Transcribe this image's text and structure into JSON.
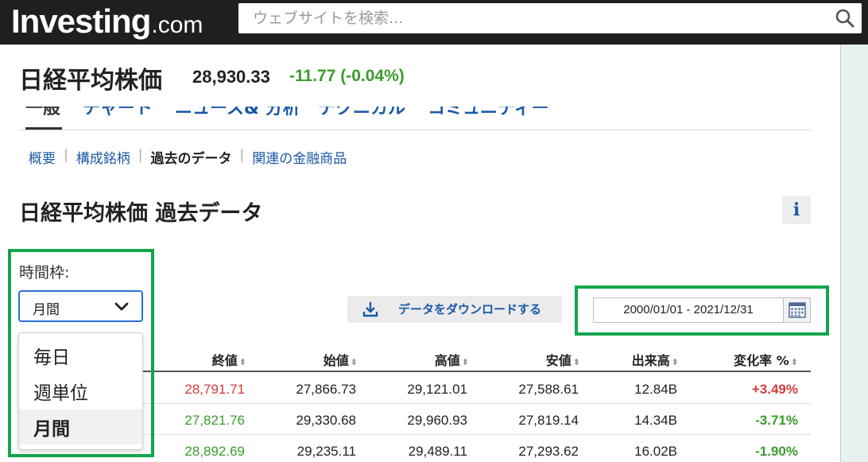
{
  "header": {
    "logo_main": "Investing",
    "logo_suffix": ".com",
    "search_placeholder": "ウェブサイトを検索..."
  },
  "instrument": {
    "name": "日経平均株価",
    "price": "28,930.33",
    "change": "-11.77",
    "change_pct": "(-0.04%)"
  },
  "tabs": [
    {
      "label": "一般",
      "active": true
    },
    {
      "label": "チャート",
      "active": false
    },
    {
      "label": "ニュース& 分析",
      "active": false
    },
    {
      "label": "テクニカル",
      "active": false
    },
    {
      "label": "コミュニティー",
      "active": false
    }
  ],
  "subnav": [
    {
      "label": "概要",
      "current": false
    },
    {
      "label": "構成銘柄",
      "current": false
    },
    {
      "label": "過去のデータ",
      "current": true
    },
    {
      "label": "関連の金融商品",
      "current": false
    }
  ],
  "section_title": "日経平均株価 過去データ",
  "info_label": "i",
  "timeframe": {
    "label": "時間枠:",
    "selected": "月間",
    "options": [
      {
        "label": "毎日",
        "selected": false
      },
      {
        "label": "週単位",
        "selected": false
      },
      {
        "label": "月間",
        "selected": true
      }
    ]
  },
  "download_label": "データをダウンロードする",
  "date_range": "2000/01/01 - 2021/12/31",
  "table": {
    "columns": [
      "終値",
      "始値",
      "高値",
      "安値",
      "出来高",
      "変化率 %"
    ],
    "rows": [
      {
        "close": "28,791.71",
        "open": "27,866.73",
        "high": "29,121.01",
        "low": "27,588.61",
        "volume": "12.84B",
        "change": "+3.49%",
        "dir": "up"
      },
      {
        "close": "27,821.76",
        "open": "29,330.68",
        "high": "29,960.93",
        "low": "27,819.14",
        "volume": "14.34B",
        "change": "-3.71%",
        "dir": "down"
      },
      {
        "close": "28,892.69",
        "open": "29,235.11",
        "high": "29,489.11",
        "low": "27,293.62",
        "volume": "16.02B",
        "change": "-1.90%",
        "dir": "down"
      }
    ]
  },
  "colors": {
    "positive": "#d63a3a",
    "negative": "#3a9b2c",
    "link": "#1a5aa6",
    "highlight": "#14a44d"
  }
}
